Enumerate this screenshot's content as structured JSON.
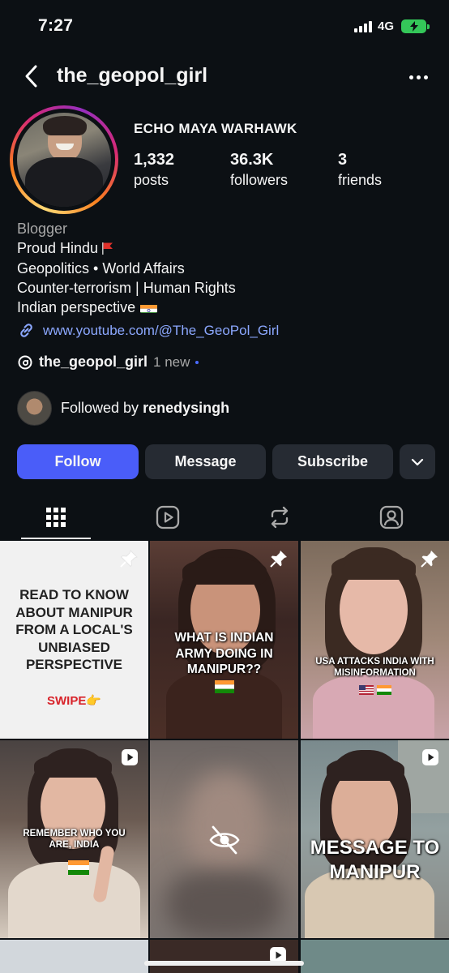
{
  "status_bar": {
    "time": "7:27",
    "network": "4G",
    "battery_color": "#34c759"
  },
  "header": {
    "username": "the_geopol_girl",
    "back_icon": "chevron-left-icon",
    "more_icon": "ellipsis-icon"
  },
  "profile": {
    "display_name": "ECHO MAYA WARHAWK",
    "stats": [
      {
        "value": "1,332",
        "label": "posts"
      },
      {
        "value": "36.3K",
        "label": "followers"
      },
      {
        "value": "3",
        "label": "friends"
      }
    ],
    "category": "Blogger",
    "bio_lines": [
      "Proud Hindu",
      "Geopolitics • World Affairs",
      "Counter-terrorism | Human Rights",
      "Indian perspective"
    ],
    "link": "www.youtube.com/@The_GeoPol_Girl",
    "threads": {
      "handle": "the_geopol_girl",
      "new_label": "1 new"
    },
    "followed_by": {
      "prefix": "Followed by",
      "name": "renedysingh"
    },
    "story_ring_colors": [
      "#feda75",
      "#fa7e1e",
      "#d62976",
      "#962fbf"
    ]
  },
  "actions": {
    "follow": "Follow",
    "message": "Message",
    "subscribe": "Subscribe",
    "follow_color": "#4a5df9"
  },
  "tabs": [
    {
      "name": "grid",
      "icon": "grid-icon",
      "selected": true
    },
    {
      "name": "reels",
      "icon": "reels-icon",
      "selected": false
    },
    {
      "name": "reposts",
      "icon": "repost-icon",
      "selected": false
    },
    {
      "name": "tagged",
      "icon": "tagged-person-icon",
      "selected": false
    }
  ],
  "grid_posts": [
    {
      "text": "READ TO KNOW ABOUT MANIPUR FROM A LOCAL'S UNBIASED PERSPECTIVE",
      "cta": "SWIPE👉",
      "badge": "pin-icon"
    },
    {
      "text": "WHAT IS INDIAN ARMY DOING IN MANIPUR??",
      "badge": "pin-icon"
    },
    {
      "text": "USA ATTACKS INDIA WITH MISINFORMATION",
      "badge": "pin-icon"
    },
    {
      "text": "REMEMBER WHO YOU ARE, INDIA",
      "badge": "reel-icon"
    },
    {
      "text": "",
      "badge": "hidden-eye-icon"
    },
    {
      "text": "MESSAGE TO MANIPUR",
      "badge": "reel-icon"
    }
  ]
}
